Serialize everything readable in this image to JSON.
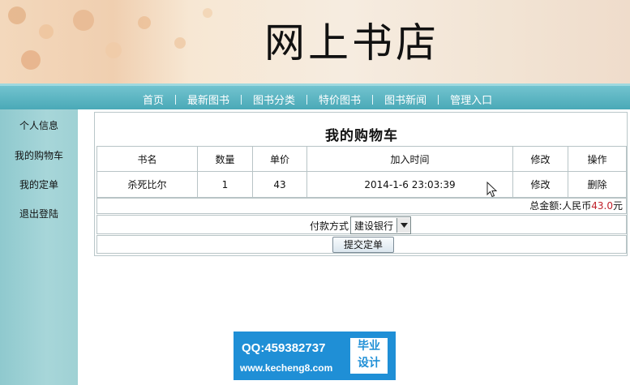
{
  "header": {
    "site_title": "网上书店"
  },
  "nav": {
    "items": [
      {
        "label": "首页"
      },
      {
        "label": "最新图书"
      },
      {
        "label": "图书分类"
      },
      {
        "label": "特价图书"
      },
      {
        "label": "图书新闻"
      },
      {
        "label": "管理入口"
      }
    ]
  },
  "sidebar": {
    "items": [
      {
        "label": "个人信息"
      },
      {
        "label": "我的购物车"
      },
      {
        "label": "我的定单"
      },
      {
        "label": "退出登陆"
      }
    ]
  },
  "cart": {
    "title": "我的购物车",
    "columns": [
      "书名",
      "数量",
      "单价",
      "加入时间",
      "修改",
      "操作"
    ],
    "rows": [
      {
        "name": "杀死比尔",
        "qty": "1",
        "price": "43",
        "added": "2014-1-6 23:03:39",
        "edit": "修改",
        "delete": "删除"
      }
    ],
    "total_label": "总金额:人民币",
    "total_amount": "43.0",
    "total_unit": "元",
    "payment_label": "付款方式",
    "payment_selected": "建设银行",
    "submit_label": "提交定单"
  },
  "watermark": {
    "qq": "QQ:459382737",
    "url": "www.kecheng8.com",
    "badge_line1": "毕业",
    "badge_line2": "设计"
  },
  "colors": {
    "nav_bg": "#4aa9b7",
    "sidebar_bg": "#9fd1d4",
    "watermark_bg": "#1f8fd6",
    "total_amount": "#c0202a"
  }
}
